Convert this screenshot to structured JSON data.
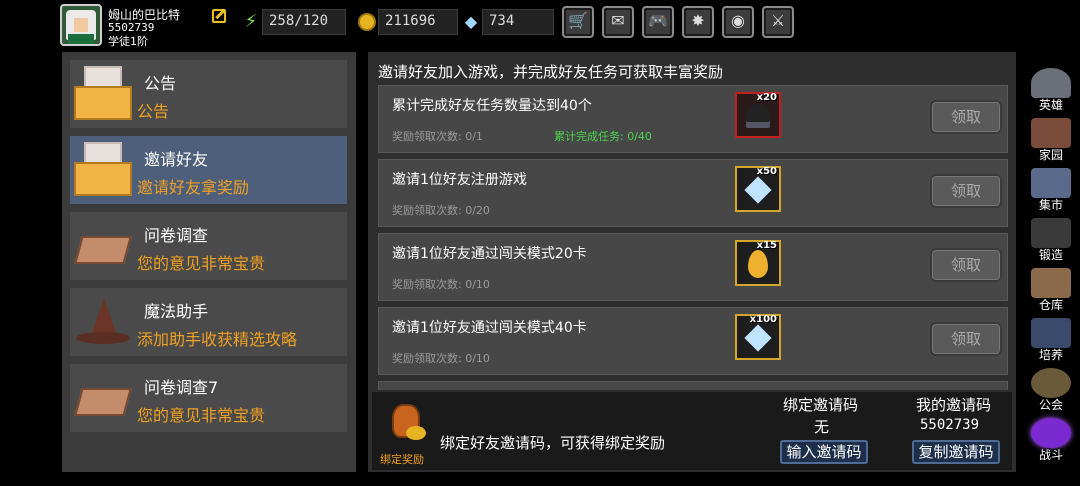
{
  "player": {
    "name": "姆山的巴比特",
    "id": "5502739",
    "rank": "学徒1阶"
  },
  "resources": {
    "energy": "258/120",
    "gold": "211696",
    "gems": "734"
  },
  "top_buttons": [
    "shop-cart-icon",
    "mail-icon",
    "gamepad-icon",
    "settings-gear-icon",
    "color-wheel-icon",
    "battle-sword-icon"
  ],
  "menu": [
    {
      "title": "公告",
      "subtitle": "公告",
      "icon": "envelope-icon",
      "active": false
    },
    {
      "title": "邀请好友",
      "subtitle": "邀请好友拿奖励",
      "icon": "envelope-icon",
      "active": true
    },
    {
      "title": "问卷调查",
      "subtitle": "您的意见非常宝贵",
      "icon": "hand-icon",
      "active": false
    },
    {
      "title": "魔法助手",
      "subtitle": "添加助手收获精选攻略",
      "icon": "wizard-hat-icon",
      "active": false
    },
    {
      "title": "问卷调查7",
      "subtitle": "您的意见非常宝贵",
      "icon": "hand-icon",
      "active": false
    }
  ],
  "main": {
    "header": "邀请好友加入游戏，并完成好友任务可获取丰富奖励",
    "tasks": [
      {
        "title": "累计完成好友任务数量达到40个",
        "count": "奖励领取次数: 0/1",
        "progress": "累计完成任务: 0/40",
        "reward_qty": "x20",
        "reward_icon": "dark-character-icon",
        "claim": "领取"
      },
      {
        "title": "邀请1位好友注册游戏",
        "count": "奖励领取次数: 0/20",
        "progress": "",
        "reward_qty": "x50",
        "reward_icon": "diamond-icon",
        "claim": "领取"
      },
      {
        "title": "邀请1位好友通过闯关模式20卡",
        "count": "奖励领取次数: 0/10",
        "progress": "",
        "reward_qty": "x15",
        "reward_icon": "gold-egg-icon",
        "claim": "领取"
      },
      {
        "title": "邀请1位好友通过闯关模式40卡",
        "count": "奖励领取次数: 0/10",
        "progress": "",
        "reward_qty": "x100",
        "reward_icon": "diamond-icon",
        "claim": "领取"
      }
    ]
  },
  "bind": {
    "icon_label": "绑定奖励",
    "text": "绑定好友邀请码，可获得绑定奖励",
    "bound_code_label": "绑定邀请码",
    "bound_code_value": "无",
    "my_code_label": "我的邀请码",
    "my_code_value": "5502739",
    "input_button": "输入邀请码",
    "copy_button": "复制邀请码"
  },
  "sidebar": [
    {
      "label": "英雄",
      "icon": "helmet-icon"
    },
    {
      "label": "家园",
      "icon": "castle-icon"
    },
    {
      "label": "集市",
      "icon": "market-icon"
    },
    {
      "label": "锻造",
      "icon": "anvil-icon"
    },
    {
      "label": "仓库",
      "icon": "storage-icon"
    },
    {
      "label": "培养",
      "icon": "training-icon"
    },
    {
      "label": "公会",
      "icon": "guild-icon"
    },
    {
      "label": "战斗",
      "icon": "portal-icon"
    }
  ],
  "colors": {
    "accent_orange": "#f0a020",
    "progress_green": "#4cd34c",
    "active_tab": "#4d5f7a"
  }
}
